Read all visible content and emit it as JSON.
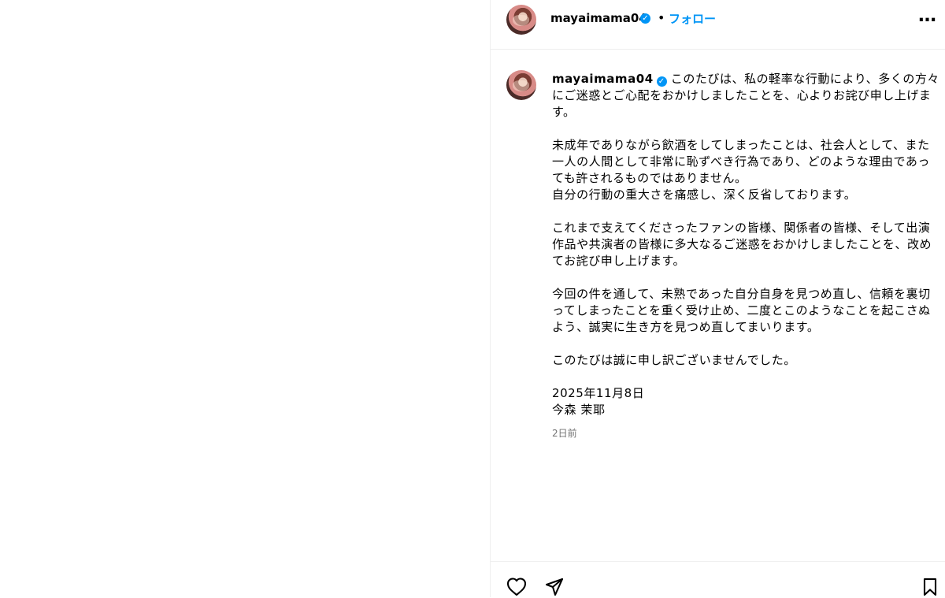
{
  "post": {
    "username": "mayaimama04",
    "verified_icon": "verified-badge-icon",
    "follow_dot": "•",
    "follow_label": "フォロー",
    "more_icon": "more-options-icon",
    "more_label": "…",
    "caption": "このたびは、私の軽率な行動により、多くの方々にご迷惑とご心配をおかけしましたことを、心よりお詫び申し上げます。\n\n未成年でありながら飲酒をしてしまったことは、社会人として、また一人の人間として非常に恥ずべき行為であり、どのような理由であっても許されるものではありません。\n自分の行動の重大さを痛感し、深く反省しております。\n\nこれまで支えてくださったファンの皆様、関係者の皆様、そして出演作品や共演者の皆様に多大なるご迷惑をおかけしましたことを、改めてお詫び申し上げます。\n\n今回の件を通して、未熟であった自分自身を見つめ直し、信頼を裏切ってしまったことを重く受け止め、二度とこのようなことを起こさぬよう、誠実に生き方を見つめ直してまいります。\n\nこのたびは誠に申し訳ございませんでした。\n\n2025年11月8日\n今森 茉耶",
    "time": "2日前"
  },
  "actions": {
    "like_icon": "heart-icon",
    "share_icon": "send-icon",
    "save_icon": "bookmark-icon"
  },
  "colors": {
    "accent": "#0095f6",
    "border": "#efefef",
    "secondary_text": "#737373"
  }
}
